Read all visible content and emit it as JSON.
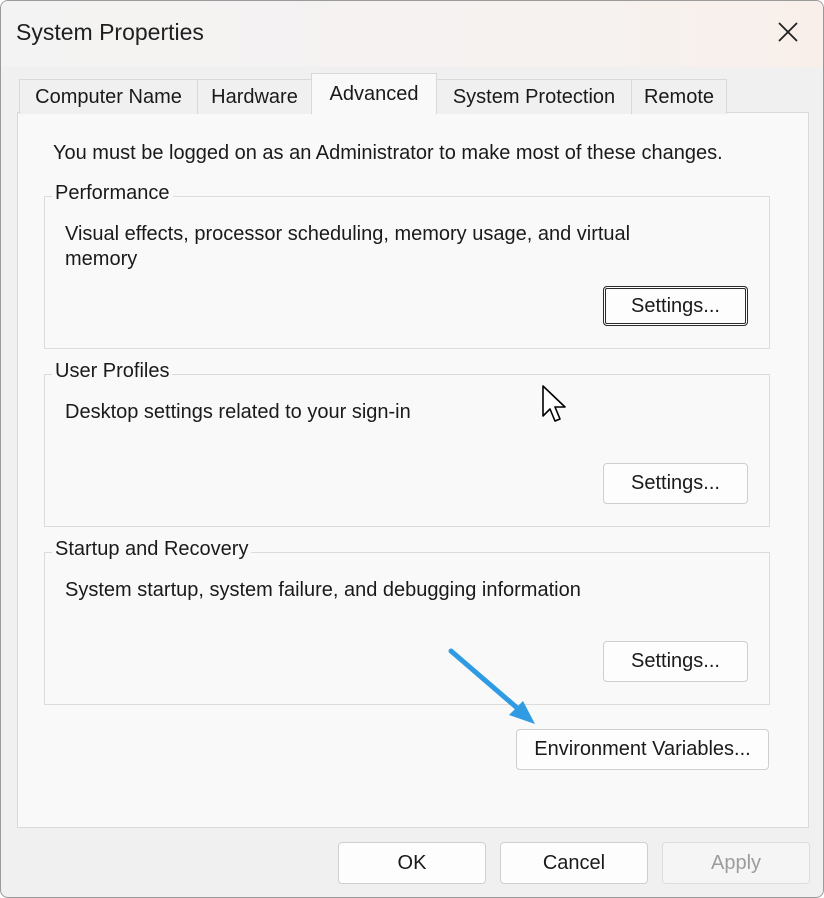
{
  "window": {
    "title": "System Properties"
  },
  "tabs": [
    {
      "label": "Computer Name"
    },
    {
      "label": "Hardware"
    },
    {
      "label": "Advanced",
      "active": true
    },
    {
      "label": "System Protection"
    },
    {
      "label": "Remote"
    }
  ],
  "notice": "You must be logged on as an Administrator to make most of these changes.",
  "groups": {
    "performance": {
      "title": "Performance",
      "description": "Visual effects, processor scheduling, memory usage, and virtual memory",
      "button": "Settings..."
    },
    "user_profiles": {
      "title": "User Profiles",
      "description": "Desktop settings related to your sign-in",
      "button": "Settings..."
    },
    "startup_recovery": {
      "title": "Startup and Recovery",
      "description": "System startup, system failure, and debugging information",
      "button": "Settings..."
    }
  },
  "environment_button": "Environment Variables...",
  "footer": {
    "ok": "OK",
    "cancel": "Cancel",
    "apply": "Apply"
  },
  "colors": {
    "annotation_arrow": "#2e9be3"
  },
  "icons": {
    "close": "close-icon",
    "pointer": "mouse-pointer-icon",
    "annotation": "annotation-arrow-icon"
  }
}
